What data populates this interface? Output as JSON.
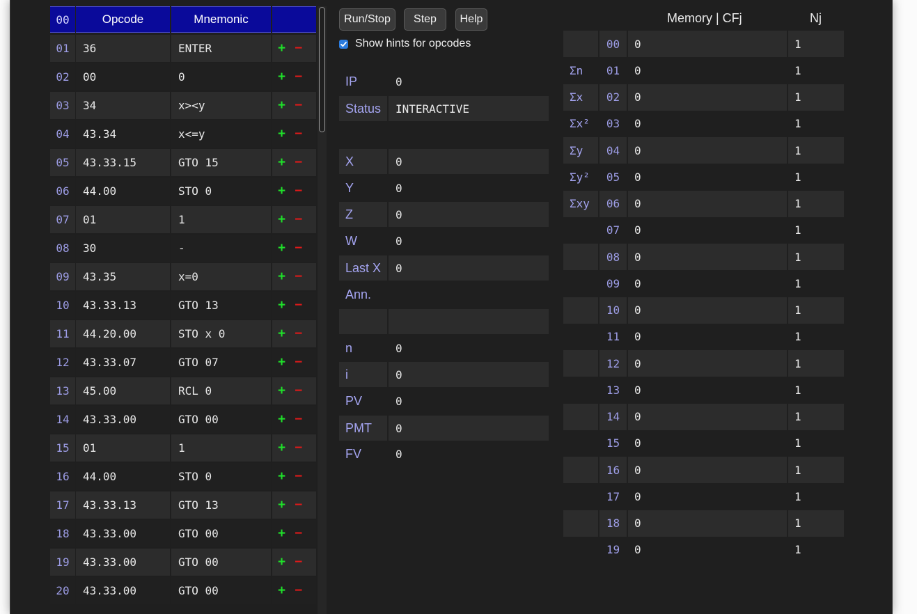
{
  "program": {
    "headers": {
      "num": "00",
      "opcode": "Opcode",
      "mnemonic": "Mnemonic"
    },
    "plus_symbol": "+",
    "minus_symbol": "−",
    "rows": [
      {
        "num": "01",
        "opcode": "36",
        "mnemonic": "ENTER"
      },
      {
        "num": "02",
        "opcode": "00",
        "mnemonic": "0"
      },
      {
        "num": "03",
        "opcode": "34",
        "mnemonic": "x><y"
      },
      {
        "num": "04",
        "opcode": "43.34",
        "mnemonic": "x<=y"
      },
      {
        "num": "05",
        "opcode": "43.33.15",
        "mnemonic": "GTO 15"
      },
      {
        "num": "06",
        "opcode": "44.00",
        "mnemonic": "STO 0"
      },
      {
        "num": "07",
        "opcode": "01",
        "mnemonic": "1"
      },
      {
        "num": "08",
        "opcode": "30",
        "mnemonic": "-"
      },
      {
        "num": "09",
        "opcode": "43.35",
        "mnemonic": "x=0"
      },
      {
        "num": "10",
        "opcode": "43.33.13",
        "mnemonic": "GTO 13"
      },
      {
        "num": "11",
        "opcode": "44.20.00",
        "mnemonic": "STO x 0"
      },
      {
        "num": "12",
        "opcode": "43.33.07",
        "mnemonic": "GTO 07"
      },
      {
        "num": "13",
        "opcode": "45.00",
        "mnemonic": "RCL 0"
      },
      {
        "num": "14",
        "opcode": "43.33.00",
        "mnemonic": "GTO 00"
      },
      {
        "num": "15",
        "opcode": "01",
        "mnemonic": "1"
      },
      {
        "num": "16",
        "opcode": "44.00",
        "mnemonic": "STO 0"
      },
      {
        "num": "17",
        "opcode": "43.33.13",
        "mnemonic": "GTO 13"
      },
      {
        "num": "18",
        "opcode": "43.33.00",
        "mnemonic": "GTO 00"
      },
      {
        "num": "19",
        "opcode": "43.33.00",
        "mnemonic": "GTO 00"
      },
      {
        "num": "20",
        "opcode": "43.33.00",
        "mnemonic": "GTO 00"
      }
    ]
  },
  "controls": {
    "run_stop": "Run/Stop",
    "step": "Step",
    "help": "Help",
    "show_hints_label": "Show hints for opcodes",
    "show_hints_checked": true
  },
  "registers": {
    "ip": {
      "label": "IP",
      "value": "0"
    },
    "status": {
      "label": "Status",
      "value": "INTERACTIVE"
    },
    "x": {
      "label": "X",
      "value": "0"
    },
    "y": {
      "label": "Y",
      "value": "0"
    },
    "z": {
      "label": "Z",
      "value": "0"
    },
    "w": {
      "label": "W",
      "value": "0"
    },
    "last_x": {
      "label": "Last X",
      "value": "0"
    },
    "ann": {
      "label": "Ann.",
      "value": ""
    },
    "blank": {
      "label": "",
      "value": ""
    },
    "n": {
      "label": "n",
      "value": "0"
    },
    "i": {
      "label": "i",
      "value": "0"
    },
    "pv": {
      "label": "PV",
      "value": "0"
    },
    "pmt": {
      "label": "PMT",
      "value": "0"
    },
    "fv": {
      "label": "FV",
      "value": "0"
    }
  },
  "memory": {
    "header_memory": "Memory | CFj",
    "header_nj": "Nj",
    "rows": [
      {
        "label": "",
        "index": "00",
        "value": "0",
        "nj": "1"
      },
      {
        "label": "Σn",
        "index": "01",
        "value": "0",
        "nj": "1"
      },
      {
        "label": "Σx",
        "index": "02",
        "value": "0",
        "nj": "1"
      },
      {
        "label": "Σx²",
        "index": "03",
        "value": "0",
        "nj": "1"
      },
      {
        "label": "Σy",
        "index": "04",
        "value": "0",
        "nj": "1"
      },
      {
        "label": "Σy²",
        "index": "05",
        "value": "0",
        "nj": "1"
      },
      {
        "label": "Σxy",
        "index": "06",
        "value": "0",
        "nj": "1"
      },
      {
        "label": "",
        "index": "07",
        "value": "0",
        "nj": "1"
      },
      {
        "label": "",
        "index": "08",
        "value": "0",
        "nj": "1"
      },
      {
        "label": "",
        "index": "09",
        "value": "0",
        "nj": "1"
      },
      {
        "label": "",
        "index": "10",
        "value": "0",
        "nj": "1"
      },
      {
        "label": "",
        "index": "11",
        "value": "0",
        "nj": "1"
      },
      {
        "label": "",
        "index": "12",
        "value": "0",
        "nj": "1"
      },
      {
        "label": "",
        "index": "13",
        "value": "0",
        "nj": "1"
      },
      {
        "label": "",
        "index": "14",
        "value": "0",
        "nj": "1"
      },
      {
        "label": "",
        "index": "15",
        "value": "0",
        "nj": "1"
      },
      {
        "label": "",
        "index": "16",
        "value": "0",
        "nj": "1"
      },
      {
        "label": "",
        "index": "17",
        "value": "0",
        "nj": "1"
      },
      {
        "label": "",
        "index": "18",
        "value": "0",
        "nj": "1"
      },
      {
        "label": "",
        "index": "19",
        "value": "0",
        "nj": "1"
      }
    ]
  }
}
